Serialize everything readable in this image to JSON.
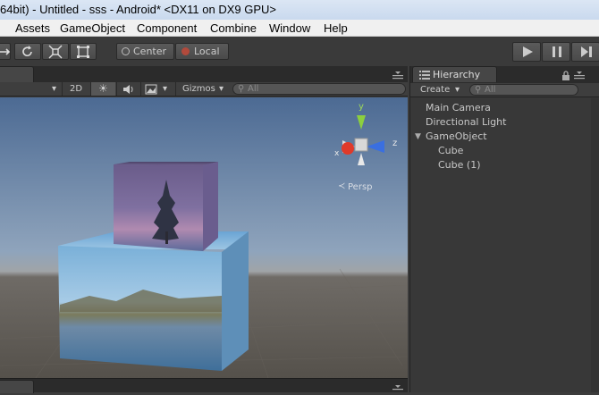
{
  "window": {
    "title": "64bit) - Untitled - sss - Android* <DX11 on DX9 GPU>"
  },
  "menu": {
    "items": [
      "Assets",
      "GameObject",
      "Component",
      "Combine",
      "Window",
      "Help"
    ]
  },
  "toolbar": {
    "pivot_label": "Center",
    "space_label": "Local"
  },
  "scene_bar": {
    "mode_2d": "2D",
    "gizmos_label": "Gizmos",
    "search_placeholder": "All",
    "persp_label": "Persp"
  },
  "gizmo": {
    "x_label": "x",
    "y_label": "y",
    "z_label": "z",
    "colors": {
      "x": "#e03a2a",
      "y": "#8ccf3e",
      "z": "#3a6fe0"
    }
  },
  "hierarchy": {
    "tab_label": "Hierarchy",
    "create_label": "Create",
    "search_placeholder": "All",
    "items": [
      "Main Camera",
      "Directional Light",
      "GameObject",
      "Cube",
      "Cube (1)"
    ]
  }
}
